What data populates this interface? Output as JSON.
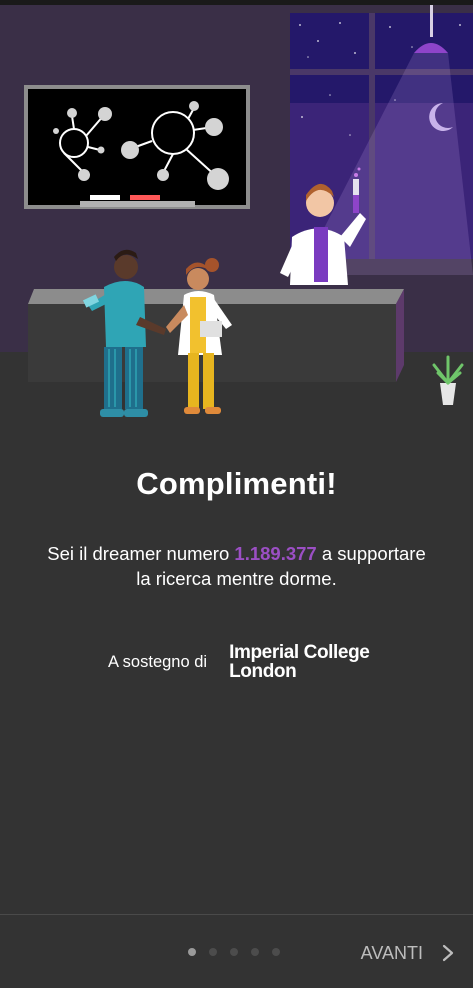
{
  "onboarding": {
    "headline": "Complimenti!",
    "message_before": "Sei il dreamer numero ",
    "dreamer_count": "1.189.377",
    "message_after": " a supportare la ricerca mentre dorme.",
    "support_label": "A sostegno di",
    "partner_logo_line1": "Imperial College",
    "partner_logo_line2": "London",
    "accent_color": "#9b4fc4",
    "page_indicator": {
      "total": 5,
      "current": 1
    }
  },
  "footer": {
    "next_label": "AVANTI",
    "next_icon": "chevron-right-icon"
  },
  "illustration": {
    "icon": "laboratory-illustration"
  }
}
